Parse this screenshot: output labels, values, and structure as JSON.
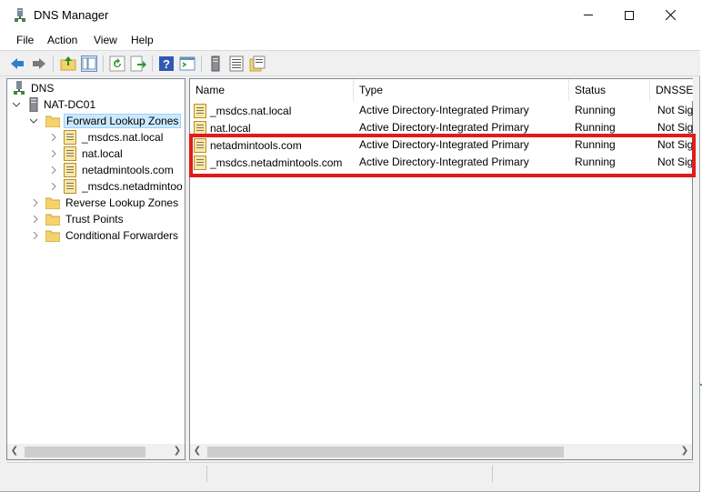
{
  "window": {
    "title": "DNS Manager"
  },
  "menu": [
    "File",
    "Action",
    "View",
    "Help"
  ],
  "toolbar": [
    "back-icon",
    "forward-icon",
    "up-folder-icon",
    "show-hide-tree-icon",
    "refresh-icon",
    "export-list-icon",
    "help-icon",
    "console-icon",
    "server-icon",
    "list-view-icon",
    "properties-icon"
  ],
  "tree": {
    "root": "DNS",
    "server": "NAT-DC01",
    "forward": "Forward Lookup Zones",
    "forward_children": [
      "_msdcs.nat.local",
      "nat.local",
      "netadmintools.com",
      "_msdcs.netadmintoo"
    ],
    "reverse": "Reverse Lookup Zones",
    "trust": "Trust Points",
    "conditional": "Conditional Forwarders"
  },
  "list": {
    "columns": [
      "Name",
      "Type",
      "Status",
      "DNSSE"
    ],
    "rows": [
      {
        "name": "_msdcs.nat.local",
        "type": "Active Directory-Integrated Primary",
        "status": "Running",
        "dnssec": "Not Sig"
      },
      {
        "name": "nat.local",
        "type": "Active Directory-Integrated Primary",
        "status": "Running",
        "dnssec": "Not Sig"
      },
      {
        "name": "netadmintools.com",
        "type": "Active Directory-Integrated Primary",
        "status": "Running",
        "dnssec": "Not Sig"
      },
      {
        "name": "_msdcs.netadmintools.com",
        "type": "Active Directory-Integrated Primary",
        "status": "Running",
        "dnssec": "Not Sig"
      }
    ]
  },
  "background": {
    "edge_text": "1"
  },
  "colors": {
    "highlight": "#e01b1b",
    "selection": "#cce8ff",
    "folder": "#f6d26b"
  }
}
